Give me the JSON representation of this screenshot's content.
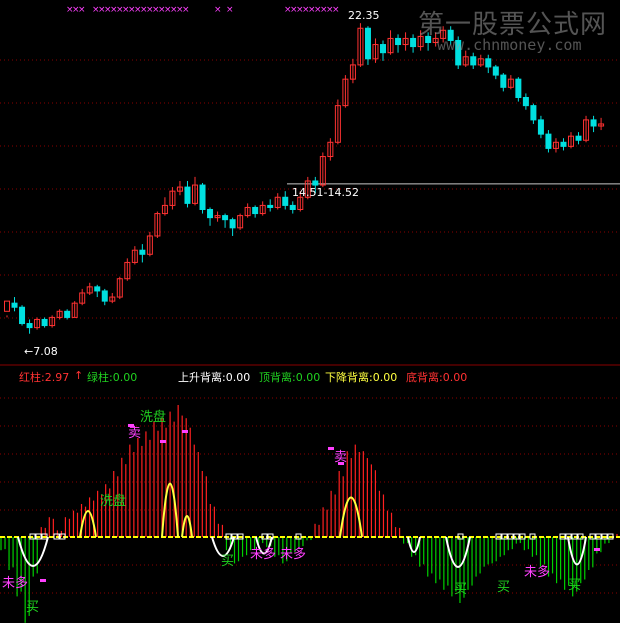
{
  "watermark": {
    "cn": "第一股票公式网",
    "url": "www.chnmoney.com"
  },
  "price_annotations": {
    "high": "22.35",
    "low": "←7.08",
    "hline_label": "14.51-14.52"
  },
  "indicator_bar": {
    "red_bar": "红柱:2.97",
    "red_arrow": "↑",
    "green_bar": "绿柱:0.00",
    "rise_div": "上升背离:0.00",
    "top_div": "顶背离:0.00",
    "fall_div": "下降背离:0.00",
    "bottom_div": "底背离:0.00"
  },
  "signal_labels": {
    "wash1": "洗盘",
    "wash2": "洗盘",
    "sell1": "卖",
    "sell2": "卖",
    "buy": [
      "买",
      "买",
      "买",
      "买",
      "买"
    ],
    "weak_buy": [
      "未多",
      "未多",
      "未多",
      "未多"
    ]
  },
  "colors": {
    "up": "#ff3232",
    "down": "#00e0e0",
    "bg": "#000000",
    "grid": "#8a0000",
    "zero": "#ffff00",
    "osc_pos": "#ff2020",
    "osc_neg": "#00d000",
    "signal": "#ffff40"
  },
  "chart_data": {
    "type": "candlestick",
    "price_range": [
      7.08,
      22.35
    ],
    "candles": [
      [
        8.2,
        8.7,
        8.0,
        7.9
      ],
      [
        8.6,
        8.4,
        8.9,
        8.2
      ],
      [
        8.4,
        7.6,
        8.5,
        7.5
      ],
      [
        7.6,
        7.4,
        7.8,
        7.1
      ],
      [
        7.4,
        7.8,
        7.9,
        7.3
      ],
      [
        7.8,
        7.5,
        7.9,
        7.4
      ],
      [
        7.5,
        7.9,
        8.0,
        7.4
      ],
      [
        7.9,
        8.2,
        8.3,
        7.8
      ],
      [
        8.2,
        7.9,
        8.3,
        7.8
      ],
      [
        7.9,
        8.6,
        8.7,
        7.9
      ],
      [
        8.6,
        9.1,
        9.3,
        8.5
      ],
      [
        9.1,
        9.4,
        9.6,
        9.0
      ],
      [
        9.4,
        9.2,
        9.5,
        8.9
      ],
      [
        9.2,
        8.7,
        9.3,
        8.5
      ],
      [
        8.7,
        8.9,
        9.1,
        8.6
      ],
      [
        8.9,
        9.8,
        9.9,
        8.8
      ],
      [
        9.8,
        10.6,
        10.8,
        9.7
      ],
      [
        10.6,
        11.2,
        11.4,
        10.5
      ],
      [
        11.2,
        11.0,
        11.5,
        10.6
      ],
      [
        11.0,
        11.9,
        12.1,
        10.9
      ],
      [
        11.9,
        13.0,
        13.1,
        11.8
      ],
      [
        13.0,
        13.4,
        13.8,
        12.9
      ],
      [
        13.4,
        14.1,
        14.3,
        13.2
      ],
      [
        14.1,
        14.3,
        14.6,
        13.9
      ],
      [
        14.3,
        13.5,
        14.6,
        13.3
      ],
      [
        13.5,
        14.4,
        14.8,
        13.4
      ],
      [
        14.4,
        13.2,
        14.5,
        13.0
      ],
      [
        13.2,
        12.8,
        13.3,
        12.4
      ],
      [
        12.8,
        12.9,
        13.1,
        12.6
      ],
      [
        12.9,
        12.7,
        13.0,
        12.3
      ],
      [
        12.7,
        12.3,
        12.8,
        11.9
      ],
      [
        12.3,
        12.9,
        13.0,
        12.2
      ],
      [
        12.9,
        13.3,
        13.5,
        12.8
      ],
      [
        13.3,
        13.0,
        13.4,
        12.8
      ],
      [
        13.0,
        13.4,
        13.6,
        12.9
      ],
      [
        13.4,
        13.3,
        13.7,
        13.1
      ],
      [
        13.3,
        13.8,
        14.0,
        13.2
      ],
      [
        13.8,
        13.4,
        14.1,
        13.2
      ],
      [
        13.4,
        13.2,
        13.6,
        13.0
      ],
      [
        13.2,
        13.8,
        14.1,
        13.1
      ],
      [
        13.8,
        14.6,
        14.8,
        13.7
      ],
      [
        14.6,
        14.4,
        14.8,
        14.0
      ],
      [
        14.4,
        15.8,
        16.0,
        14.3
      ],
      [
        15.8,
        16.5,
        16.7,
        15.6
      ],
      [
        16.5,
        18.3,
        18.6,
        16.4
      ],
      [
        18.3,
        19.6,
        19.8,
        18.2
      ],
      [
        19.6,
        20.3,
        20.6,
        19.4
      ],
      [
        20.3,
        22.1,
        22.35,
        20.2
      ],
      [
        22.1,
        20.6,
        22.2,
        20.3
      ],
      [
        20.6,
        21.3,
        21.6,
        20.4
      ],
      [
        21.3,
        20.9,
        21.5,
        20.5
      ],
      [
        20.9,
        21.6,
        22.0,
        20.8
      ],
      [
        21.6,
        21.3,
        21.8,
        20.9
      ],
      [
        21.3,
        21.6,
        21.9,
        21.0
      ],
      [
        21.6,
        21.2,
        21.8,
        20.9
      ],
      [
        21.2,
        21.7,
        22.0,
        21.0
      ],
      [
        21.7,
        21.4,
        21.9,
        21.0
      ],
      [
        21.4,
        21.6,
        21.9,
        21.2
      ],
      [
        21.6,
        22.0,
        22.2,
        21.4
      ],
      [
        22.0,
        21.5,
        22.2,
        21.3
      ],
      [
        21.5,
        20.3,
        21.7,
        20.1
      ],
      [
        20.3,
        20.7,
        21.0,
        20.2
      ],
      [
        20.7,
        20.3,
        20.9,
        20.1
      ],
      [
        20.3,
        20.6,
        20.8,
        20.2
      ],
      [
        20.6,
        20.2,
        20.8,
        19.9
      ],
      [
        20.2,
        19.8,
        20.3,
        19.6
      ],
      [
        19.8,
        19.2,
        19.9,
        19.0
      ],
      [
        19.2,
        19.6,
        19.8,
        19.1
      ],
      [
        19.6,
        18.7,
        19.7,
        18.5
      ],
      [
        18.7,
        18.3,
        18.9,
        18.1
      ],
      [
        18.3,
        17.6,
        18.4,
        17.4
      ],
      [
        17.6,
        16.9,
        17.8,
        16.7
      ],
      [
        16.9,
        16.2,
        17.1,
        16.0
      ],
      [
        16.2,
        16.5,
        16.7,
        16.0
      ],
      [
        16.5,
        16.3,
        16.7,
        16.1
      ],
      [
        16.3,
        16.8,
        17.0,
        16.2
      ],
      [
        16.8,
        16.6,
        17.0,
        16.4
      ],
      [
        16.6,
        17.6,
        17.8,
        16.5
      ],
      [
        17.6,
        17.3,
        17.8,
        17.0
      ],
      [
        17.3,
        17.4,
        17.7,
        17.1
      ]
    ],
    "oscillator": [
      -0.4,
      -1.0,
      -1.8,
      -2.6,
      -1.2,
      0.3,
      0.6,
      0.2,
      0.6,
      0.8,
      1.0,
      1.2,
      1.4,
      1.6,
      2.0,
      2.4,
      2.8,
      3.0,
      3.2,
      3.5,
      3.6,
      3.8,
      4.0,
      3.6,
      2.8,
      2.0,
      1.0,
      0.4,
      -0.4,
      -0.8,
      -0.6,
      -0.4,
      -0.2,
      -0.3,
      -0.6,
      -0.8,
      -0.5,
      -0.3,
      -0.1,
      0.4,
      0.9,
      1.4,
      2.0,
      2.6,
      2.8,
      2.6,
      2.2,
      1.4,
      0.8,
      0.3,
      -0.2,
      -0.6,
      -0.9,
      -1.2,
      -1.4,
      -1.6,
      -1.8,
      -2.0,
      -1.6,
      -1.2,
      -0.9,
      -0.8,
      -0.6,
      -0.4,
      -0.2,
      -0.4,
      -0.6,
      -0.9,
      -1.2,
      -1.4,
      -1.6,
      -1.8,
      -1.4,
      -1.0,
      -0.5,
      -0.2,
      0.1
    ]
  }
}
